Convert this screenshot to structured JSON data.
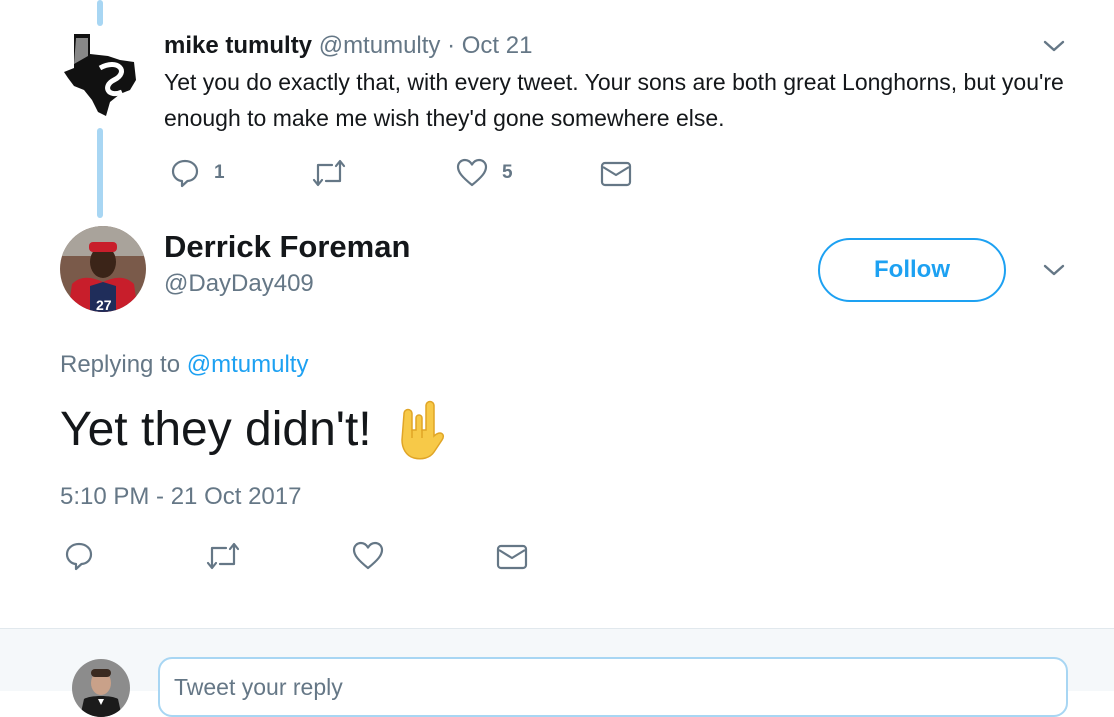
{
  "parent_tweet": {
    "name": "mike tumulty",
    "handle": "@mtumulty",
    "separator": " · ",
    "date": "Oct 21",
    "text": "Yet you do exactly that, with every tweet. Your sons are both great Longhorns, but you're enough to make me wish they'd gone somewhere else.",
    "actions": {
      "reply_count": "1",
      "like_count": "5"
    }
  },
  "main_tweet": {
    "name": "Derrick Foreman",
    "handle": "@DayDay409",
    "follow_label": "Follow",
    "replying_prefix": "Replying to ",
    "replying_handle": "@mtumulty",
    "text": "Yet they didn't!",
    "emoji": "sign-of-the-horns",
    "timestamp": "5:10 PM - 21 Oct 2017"
  },
  "reply_box": {
    "placeholder": "Tweet your reply"
  },
  "colors": {
    "accent": "#1da1f2",
    "thread_line": "#a8d6f3",
    "muted_text": "#657786",
    "primary_text": "#14171a",
    "reply_bar_bg": "#f5f8fa"
  }
}
